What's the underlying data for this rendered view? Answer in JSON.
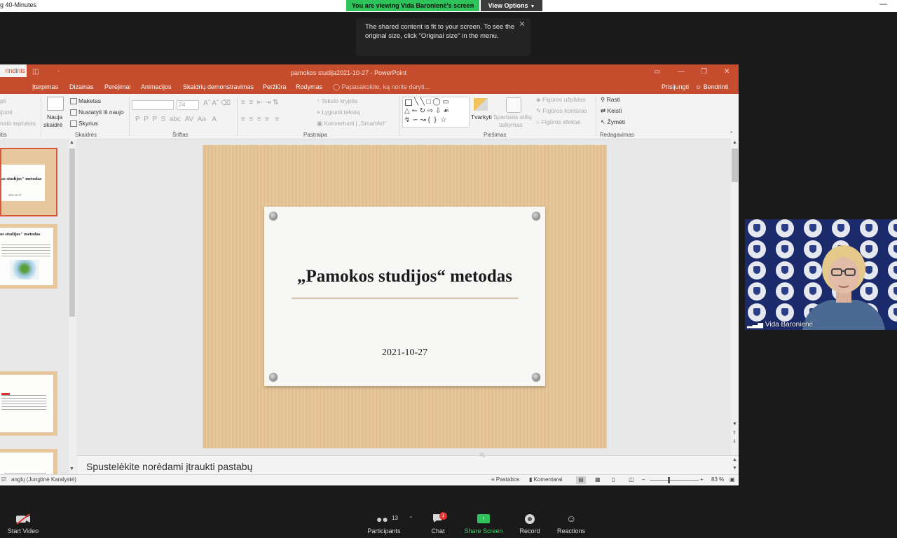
{
  "zoom": {
    "title_fragment": "g 40-Minutes",
    "share_banner": "You are viewing Vida Baronienė's screen",
    "view_options": "View Options",
    "tooltip": "The shared content is fit to your screen. To see the original size, click \"Original size\" in the menu.",
    "toolbar": {
      "start_video": "Start Video",
      "participants": "Participants",
      "participants_count": "13",
      "chat": "Chat",
      "chat_badge": "1",
      "share_screen": "Share Screen",
      "record": "Record",
      "reactions": "Reactions"
    },
    "video": {
      "name": "Vida Baronienė"
    }
  },
  "ppt": {
    "title": "pamokos studija2021-10-27 - PowerPoint",
    "tabs": [
      "Įterpimas",
      "Dizainas",
      "Perėjimai",
      "Animacijos",
      "Skaidrių demonstravimas",
      "Peržiūra",
      "Rodymas"
    ],
    "home_tab_fragment": "rindinis",
    "tell_me": "Papasakokite, ką norite daryti...",
    "sign_in": "Prisijungti",
    "share": "Bendrinti",
    "ribbon": {
      "clipboard_fragments": [
        "pti",
        "ijuoti",
        "nato teptukas"
      ],
      "clipboard_label_fragment": "itis",
      "new_slide": "Nauja",
      "new_slide_2": "skaidrė",
      "layout": "Maketas",
      "reset": "Nustatyti iš naujo",
      "section": "Skyrius",
      "slides_label": "Skaidrės",
      "font_size": "24",
      "font_label": "Šriftas",
      "text_direction": "Teksto kryptis",
      "align_text": "Lygiuoti tekstą",
      "smartart": "Konvertuoti į „SmartArt“",
      "paragraph_label": "Pastraipa",
      "arrange": "Tvarkyti",
      "quick_styles": "Spartusis stilių",
      "quick_styles_2": "taikymas",
      "shape_fill": "Figūros užpildas",
      "shape_outline": "Figūros kontūras",
      "shape_effects": "Figūros efektai",
      "drawing_label": "Piešimas",
      "find": "Rasti",
      "replace": "Keisti",
      "select": "Žymėti",
      "editing_label": "Redagavimas"
    },
    "thumbnails": [
      {
        "title": "as studijos\" metodas",
        "sub": "2021-10-27"
      },
      {
        "title": "os studijos\" metodas"
      },
      {
        "title": ""
      },
      {
        "title": ""
      }
    ],
    "slide": {
      "title": "„Pamokos studijos“ metodas",
      "date": "2021-10-27"
    },
    "notes_placeholder": "Spustelėkite norėdami įtraukti pastabų",
    "status": {
      "language": "anglų (Jungtinė Karalystė)",
      "notes": "Pastabos",
      "comments": "Komentarai",
      "zoom": "83 %"
    }
  }
}
